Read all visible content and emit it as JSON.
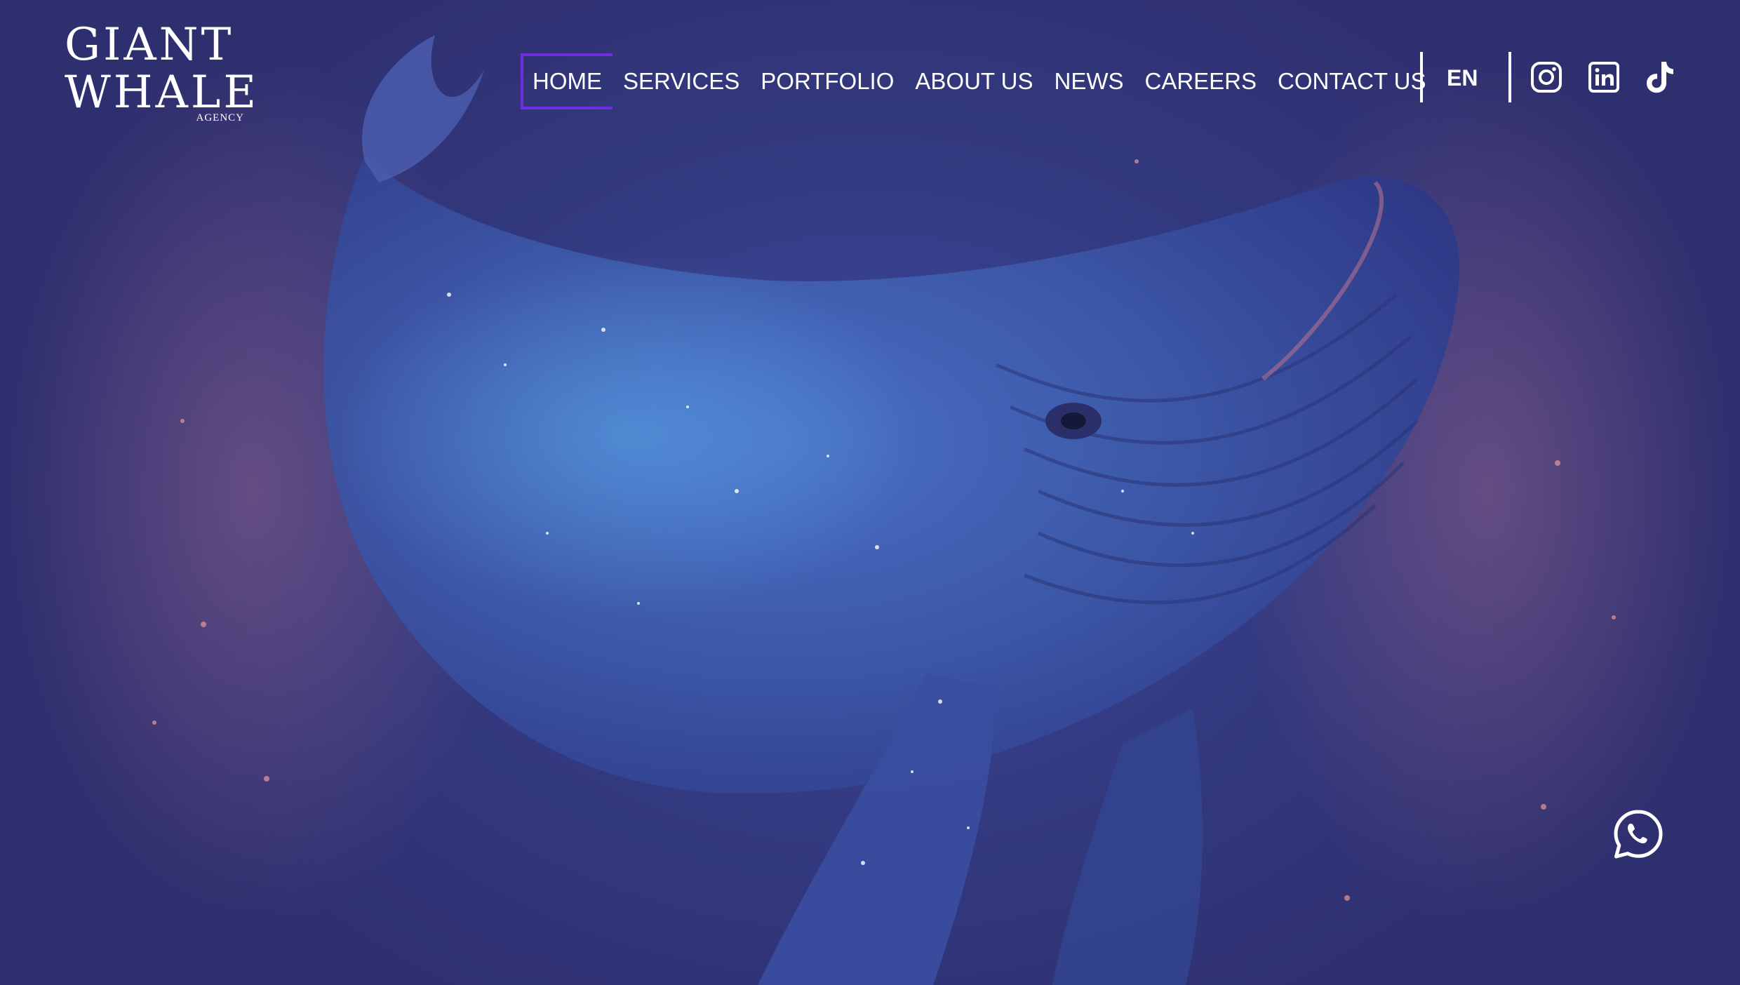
{
  "brand": {
    "logo_line1": "GIANT",
    "logo_line2": "WHALE",
    "logo_sub": "AGENCY"
  },
  "nav": {
    "items": [
      {
        "label": "HOME",
        "active": true
      },
      {
        "label": "SERVICES",
        "active": false
      },
      {
        "label": "PORTFOLIO",
        "active": false
      },
      {
        "label": "ABOUT US",
        "active": false
      },
      {
        "label": "NEWS",
        "active": false
      },
      {
        "label": "CAREERS",
        "active": false
      },
      {
        "label": "CONTACT US",
        "active": false
      }
    ]
  },
  "language": {
    "current": "EN"
  },
  "social": {
    "icons": [
      "instagram-icon",
      "linkedin-icon",
      "tiktok-icon"
    ]
  },
  "floating": {
    "icon": "whatsapp-icon"
  },
  "colors": {
    "overlay": "#34327a",
    "active_accent": "#6d2fe0",
    "text": "#ffffff"
  }
}
